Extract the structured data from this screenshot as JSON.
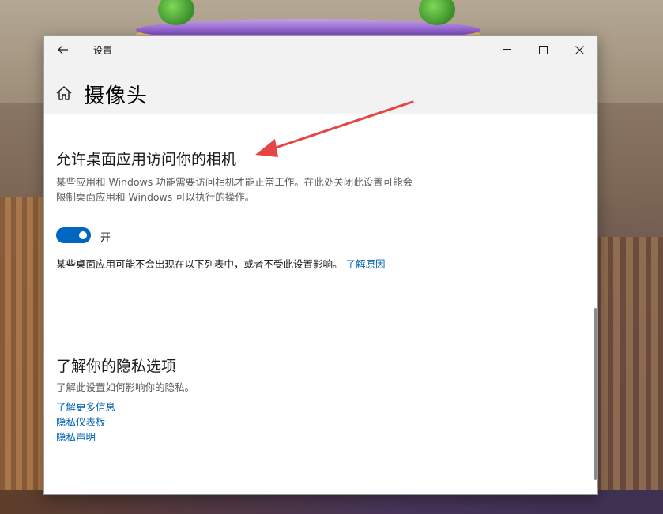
{
  "window": {
    "title": "设置",
    "page_title": "摄像头"
  },
  "section1": {
    "heading": "允许桌面应用访问你的相机",
    "description": "某些应用和 Windows 功能需要访问相机才能正常工作。在此处关闭此设置可能会限制桌面应用和 Windows 可以执行的操作。",
    "toggle_state_label": "开",
    "toggle_on": true,
    "note_text": "某些桌面应用可能不会出现在以下列表中，或者不受此设置影响。",
    "note_link": "了解原因"
  },
  "section2": {
    "heading": "了解你的隐私选项",
    "description": "了解此设置如何影响你的隐私。",
    "links": [
      "了解更多信息",
      "隐私仪表板",
      "隐私声明"
    ]
  },
  "colors": {
    "accent": "#0067c0",
    "link": "#0063b1",
    "annotation_arrow": "#e64545"
  },
  "icons": [
    "back-arrow-icon",
    "minimize-icon",
    "maximize-icon",
    "close-icon",
    "home-icon"
  ]
}
